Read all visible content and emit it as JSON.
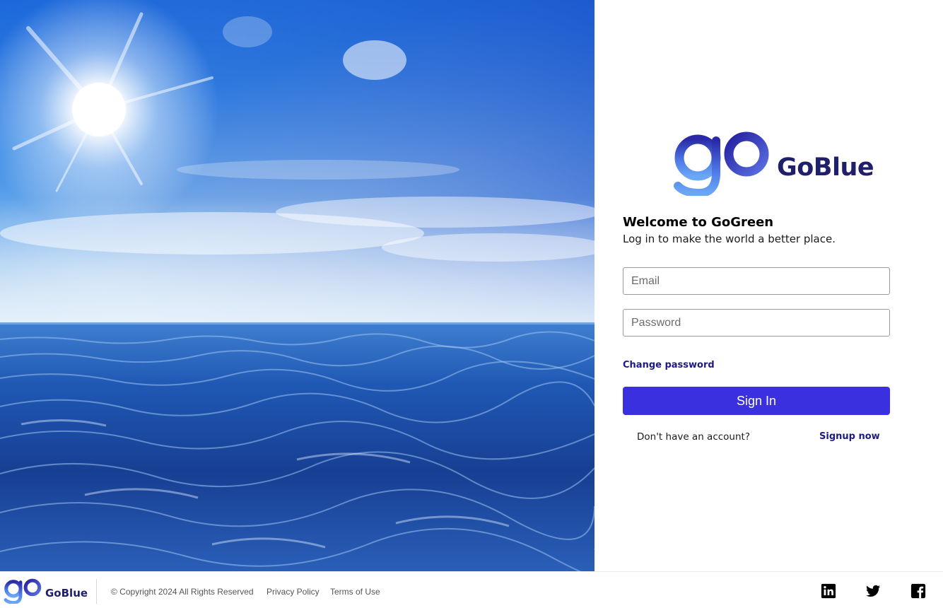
{
  "brand": {
    "name": "GoBlue",
    "primary_color": "#3a30e0",
    "text_color": "#1f1f6b"
  },
  "login": {
    "title": "Welcome to GoGreen",
    "subtitle": "Log in to make the world a better place.",
    "email_placeholder": "Email",
    "password_placeholder": "Password",
    "change_password_label": "Change password",
    "signin_label": "Sign In",
    "no_account_text": "Don't have an account?",
    "signup_label": "Signup now"
  },
  "footer": {
    "brand": "GoBlue",
    "copyright": "© Copyright 2024 All Rights Reserved",
    "privacy": "Privacy Policy",
    "terms": "Terms of Use",
    "social": [
      "linkedin-icon",
      "twitter-icon",
      "facebook-icon"
    ]
  },
  "hero": {
    "description_icon": "sky-and-ocean-image"
  }
}
